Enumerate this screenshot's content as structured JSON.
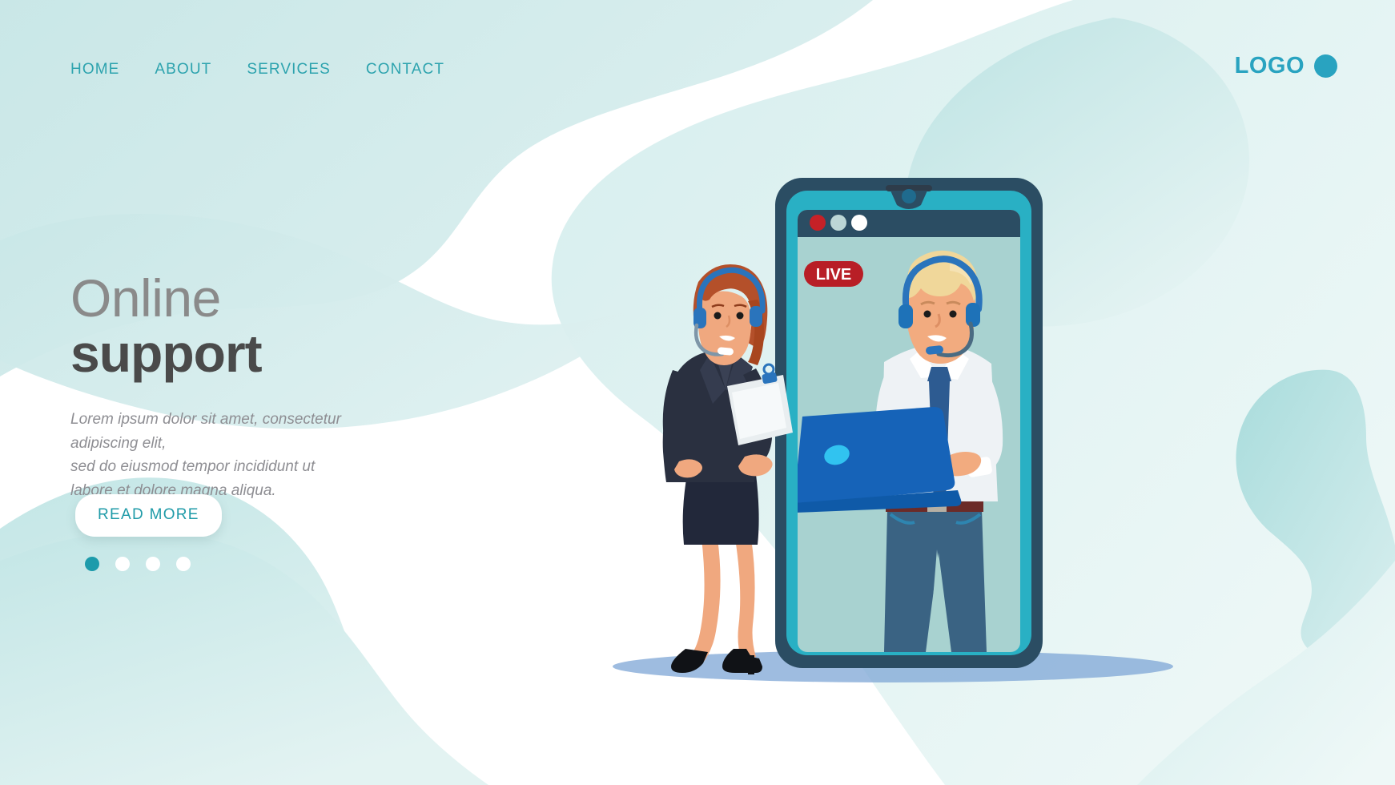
{
  "page": {
    "title": "Online support",
    "background_color": "#ffffff",
    "blob_color_light": "#cdeaea",
    "blob_color_pale": "#e5f4f4",
    "accent_teal": "#2da3ae",
    "brand_teal": "#29a3c0"
  },
  "nav": {
    "items": [
      {
        "label": "HOME"
      },
      {
        "label": "ABOUT"
      },
      {
        "label": "SERVICES"
      },
      {
        "label": "CONTACT"
      }
    ]
  },
  "brand": {
    "text": "LOGO",
    "dot_icon": "filled-circle-icon",
    "color": "#29a3c0"
  },
  "hero": {
    "title_line_1": "Online",
    "title_line_2": "support",
    "title_line_1_color": "#8a8a8a",
    "title_line_2_color": "#4a4a4a",
    "paragraph_line_1": "Lorem ipsum dolor sit amet, consectetur adipiscing elit,",
    "paragraph_line_2": "sed do eiusmod tempor incididunt ut",
    "paragraph_line_3": "labore et dolore magna aliqua.",
    "paragraph_color": "#8e8e93"
  },
  "cta": {
    "label": "READ MORE",
    "text_color": "#1f9ba8",
    "background": "#ffffff"
  },
  "carousel": {
    "total_dots": 4,
    "active_index": 1,
    "active_color": "#1d9bab",
    "inactive_color": "#ffffff"
  },
  "illustration": {
    "phone": {
      "frame_color": "#2b4d63",
      "bezel_color": "#29b0c4",
      "screen_color": "#a8d2d0",
      "notch_speaker_color": "#2e3c4a",
      "camera_color": "#1f6b8e",
      "titlebar_color": "#2b4d63",
      "window_dots": [
        {
          "name": "close-dot",
          "color": "#c62127"
        },
        {
          "name": "minimize-dot",
          "color": "#bcd6d6"
        },
        {
          "name": "maximize-dot",
          "color": "#ffffff"
        }
      ]
    },
    "live_badge": {
      "label": "LIVE",
      "background": "#b81e26",
      "text_color": "#ffffff"
    },
    "agent_male": {
      "description": "male support agent with headset holding laptop",
      "hair_color": "#f0d79a",
      "skin_color": "#f2ab7f",
      "shirt_color": "#eef2f5",
      "tie_color": "#2d5b91",
      "jeans_color": "#3a6383",
      "belt_color": "#6b2b28",
      "headset_color": "#1e72b8",
      "laptop_color": "#1663b8",
      "laptop_logo_color": "#31c3f0"
    },
    "agent_female": {
      "description": "female support agent with headset holding clipboard",
      "hair_color": "#b4502a",
      "skin_color": "#f0a87f",
      "suit_color": "#2a3040",
      "skirt_color": "#22283a",
      "necklace_color": "#e8613c",
      "headset_color": "#2a74bc",
      "clipboard_color": "#e9eef0",
      "clipboard_clip_color": "#2a74bc",
      "shoe_color": "#101216"
    },
    "ground_shadow_color": "#7da6d6"
  }
}
